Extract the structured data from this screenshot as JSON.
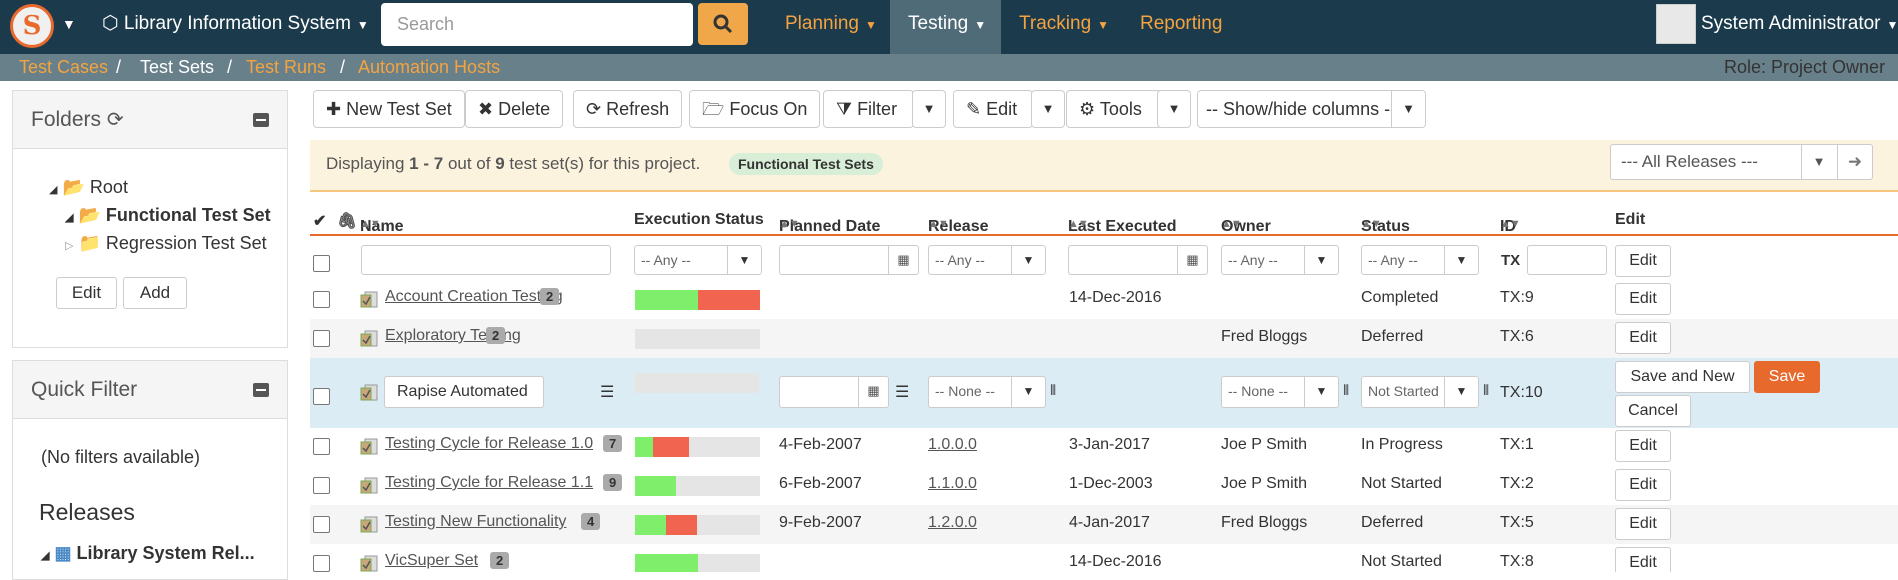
{
  "topnav": {
    "logo_letter": "S",
    "product": "Library Information System",
    "search_placeholder": "Search",
    "menus": [
      "Planning",
      "Testing",
      "Tracking",
      "Reporting"
    ],
    "user": "System Administrator"
  },
  "subnav": {
    "items": [
      "Test Cases",
      "Test Sets",
      "Test Runs",
      "Automation Hosts"
    ],
    "separator": "/",
    "role": "Role: Project Owner"
  },
  "folders": {
    "title": "Folders",
    "tree": [
      "Root",
      "Functional Test Set",
      "Regression Test Set"
    ],
    "edit_label": "Edit",
    "add_label": "Add"
  },
  "quick_filter": {
    "title": "Quick Filter",
    "empty": "(No filters available)",
    "releases_title": "Releases",
    "release_item": "Library System Rel..."
  },
  "toolbar": {
    "new": "New Test Set",
    "delete": "Delete",
    "refresh": "Refresh",
    "focus": "Focus On",
    "filter": "Filter",
    "edit": "Edit",
    "tools": "Tools",
    "show_hide": "-- Show/hide columns --"
  },
  "info": {
    "prefix": "Displaying",
    "range": "1 - 7",
    "mid": "out of",
    "total": "9",
    "suffix": "test set(s) for this project.",
    "folder_tag": "Functional Test Sets",
    "release_filter": "--- All Releases ---"
  },
  "columns": [
    "Name",
    "Execution Status",
    "Planned Date",
    "Release",
    "Last Executed",
    "Owner",
    "Status",
    "ID",
    "Edit"
  ],
  "filter_row": {
    "any": "-- Any --",
    "id_prefix": "TX",
    "edit": "Edit"
  },
  "rows": [
    {
      "name": "Account Creation Testing",
      "count": "2",
      "pass": 0.5,
      "fail": 0.5,
      "planned": "",
      "release": "",
      "last": "14-Dec-2016",
      "owner": "",
      "status": "Completed",
      "id": "TX:9",
      "edit": "Edit"
    },
    {
      "name": "Exploratory Testing",
      "count": "2",
      "pass": 0,
      "fail": 0,
      "planned": "",
      "release": "",
      "last": "",
      "owner": "Fred Bloggs",
      "status": "Deferred",
      "id": "TX:6",
      "edit": "Edit"
    },
    {
      "name": "Testing Cycle for Release 1.0",
      "count": "7",
      "pass": 0.14,
      "fail": 0.29,
      "planned": "4-Feb-2007",
      "release": "1.0.0.0",
      "last": "3-Jan-2017",
      "owner": "Joe P Smith",
      "status": "In Progress",
      "id": "TX:1",
      "edit": "Edit"
    },
    {
      "name": "Testing Cycle for Release 1.1",
      "count": "9",
      "pass": 0.33,
      "fail": 0,
      "planned": "6-Feb-2007",
      "release": "1.1.0.0",
      "last": "1-Dec-2003",
      "owner": "Joe P Smith",
      "status": "Not Started",
      "id": "TX:2",
      "edit": "Edit"
    },
    {
      "name": "Testing New Functionality",
      "count": "4",
      "pass": 0.25,
      "fail": 0.25,
      "planned": "9-Feb-2007",
      "release": "1.2.0.0",
      "last": "4-Jan-2017",
      "owner": "Fred Bloggs",
      "status": "Deferred",
      "id": "TX:5",
      "edit": "Edit"
    },
    {
      "name": "VicSuper Set",
      "count": "2",
      "pass": 0.5,
      "fail": 0,
      "planned": "",
      "release": "",
      "last": "14-Dec-2016",
      "owner": "",
      "status": "Not Started",
      "id": "TX:8",
      "edit": "Edit"
    }
  ],
  "edit_row": {
    "name": "Rapise Automated",
    "release": "-- None --",
    "owner": "-- None --",
    "status": "Not Started",
    "id": "TX:10",
    "save_new": "Save and New",
    "save": "Save",
    "cancel": "Cancel"
  },
  "colors": {
    "accent": "#e8692c",
    "nav": "#1b3a4b",
    "pass": "#7fef6b",
    "fail": "#f06450"
  }
}
